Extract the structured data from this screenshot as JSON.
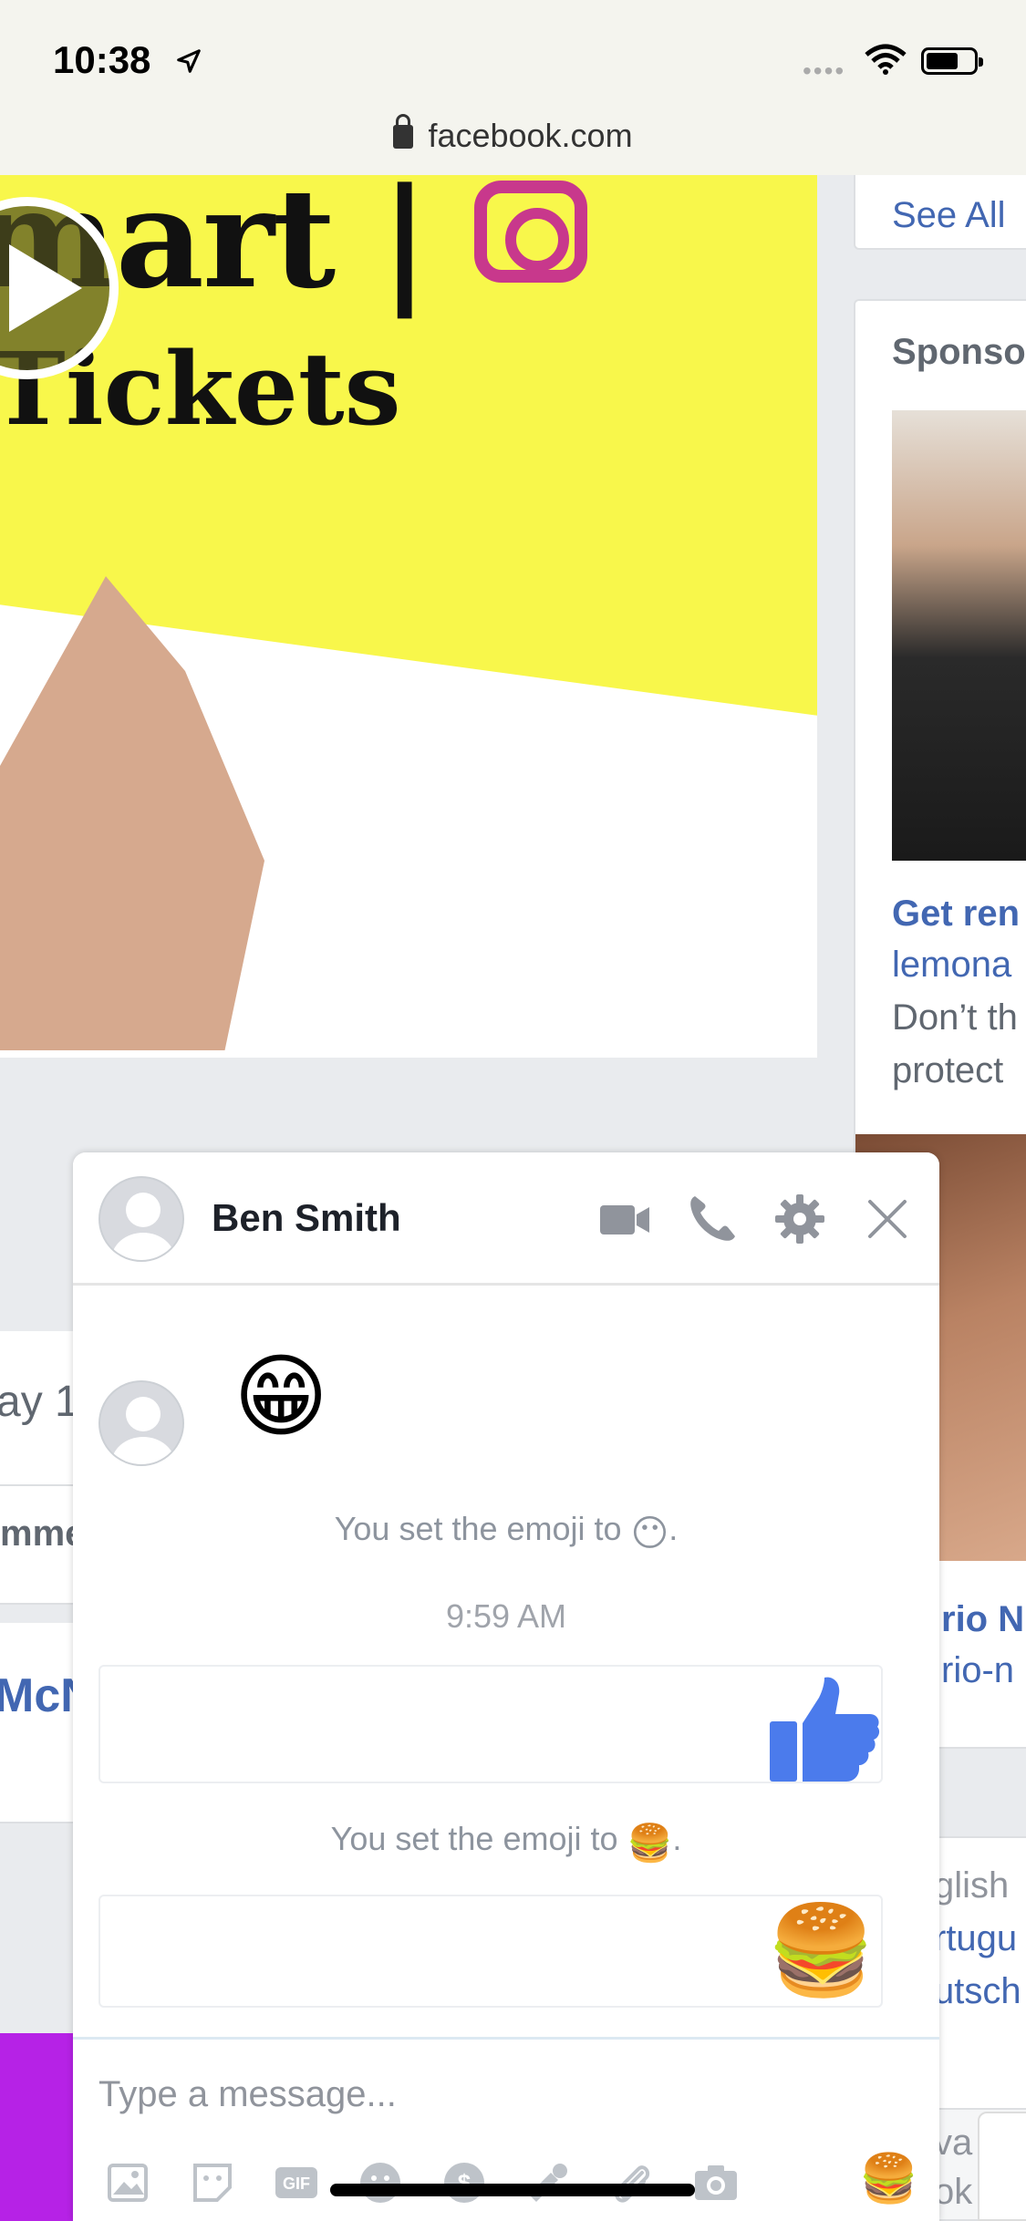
{
  "status_bar": {
    "time": "10:38"
  },
  "browser": {
    "url": "facebook.com"
  },
  "feed": {
    "poster_line1": "mart |",
    "poster_line2": "Tickets",
    "fragment_date": "ay 1",
    "fragment_comment": "mme",
    "fragment_name": "McN"
  },
  "right_column": {
    "see_all": "See All",
    "sponsored": "Sponso",
    "ad_title": "Get ren",
    "ad_domain": "lemona",
    "ad_body_line1": "Don’t th",
    "ad_body_line2": "protect",
    "ad2_title": "rio N",
    "ad2_domain": "rio-n",
    "lang1": "glish",
    "lang2": "rtugu",
    "lang3": "utsch",
    "privacy1": "va",
    "privacy2": "ok"
  },
  "chat": {
    "name": "Ben Smith",
    "partner_emoji": "😁",
    "sys_msg_prefix": "You set the emoji to",
    "sys_msg_1_emoji": "😶",
    "timestamp": "9:59 AM",
    "sys_msg_2_emoji": "🍔",
    "my_emoji": "🍔",
    "input_placeholder": "Type a message...",
    "input_value": "",
    "quick_emoji": "🍔",
    "colors": {
      "like_blue": "#4b7bec",
      "header_icon": "#90949c"
    }
  }
}
